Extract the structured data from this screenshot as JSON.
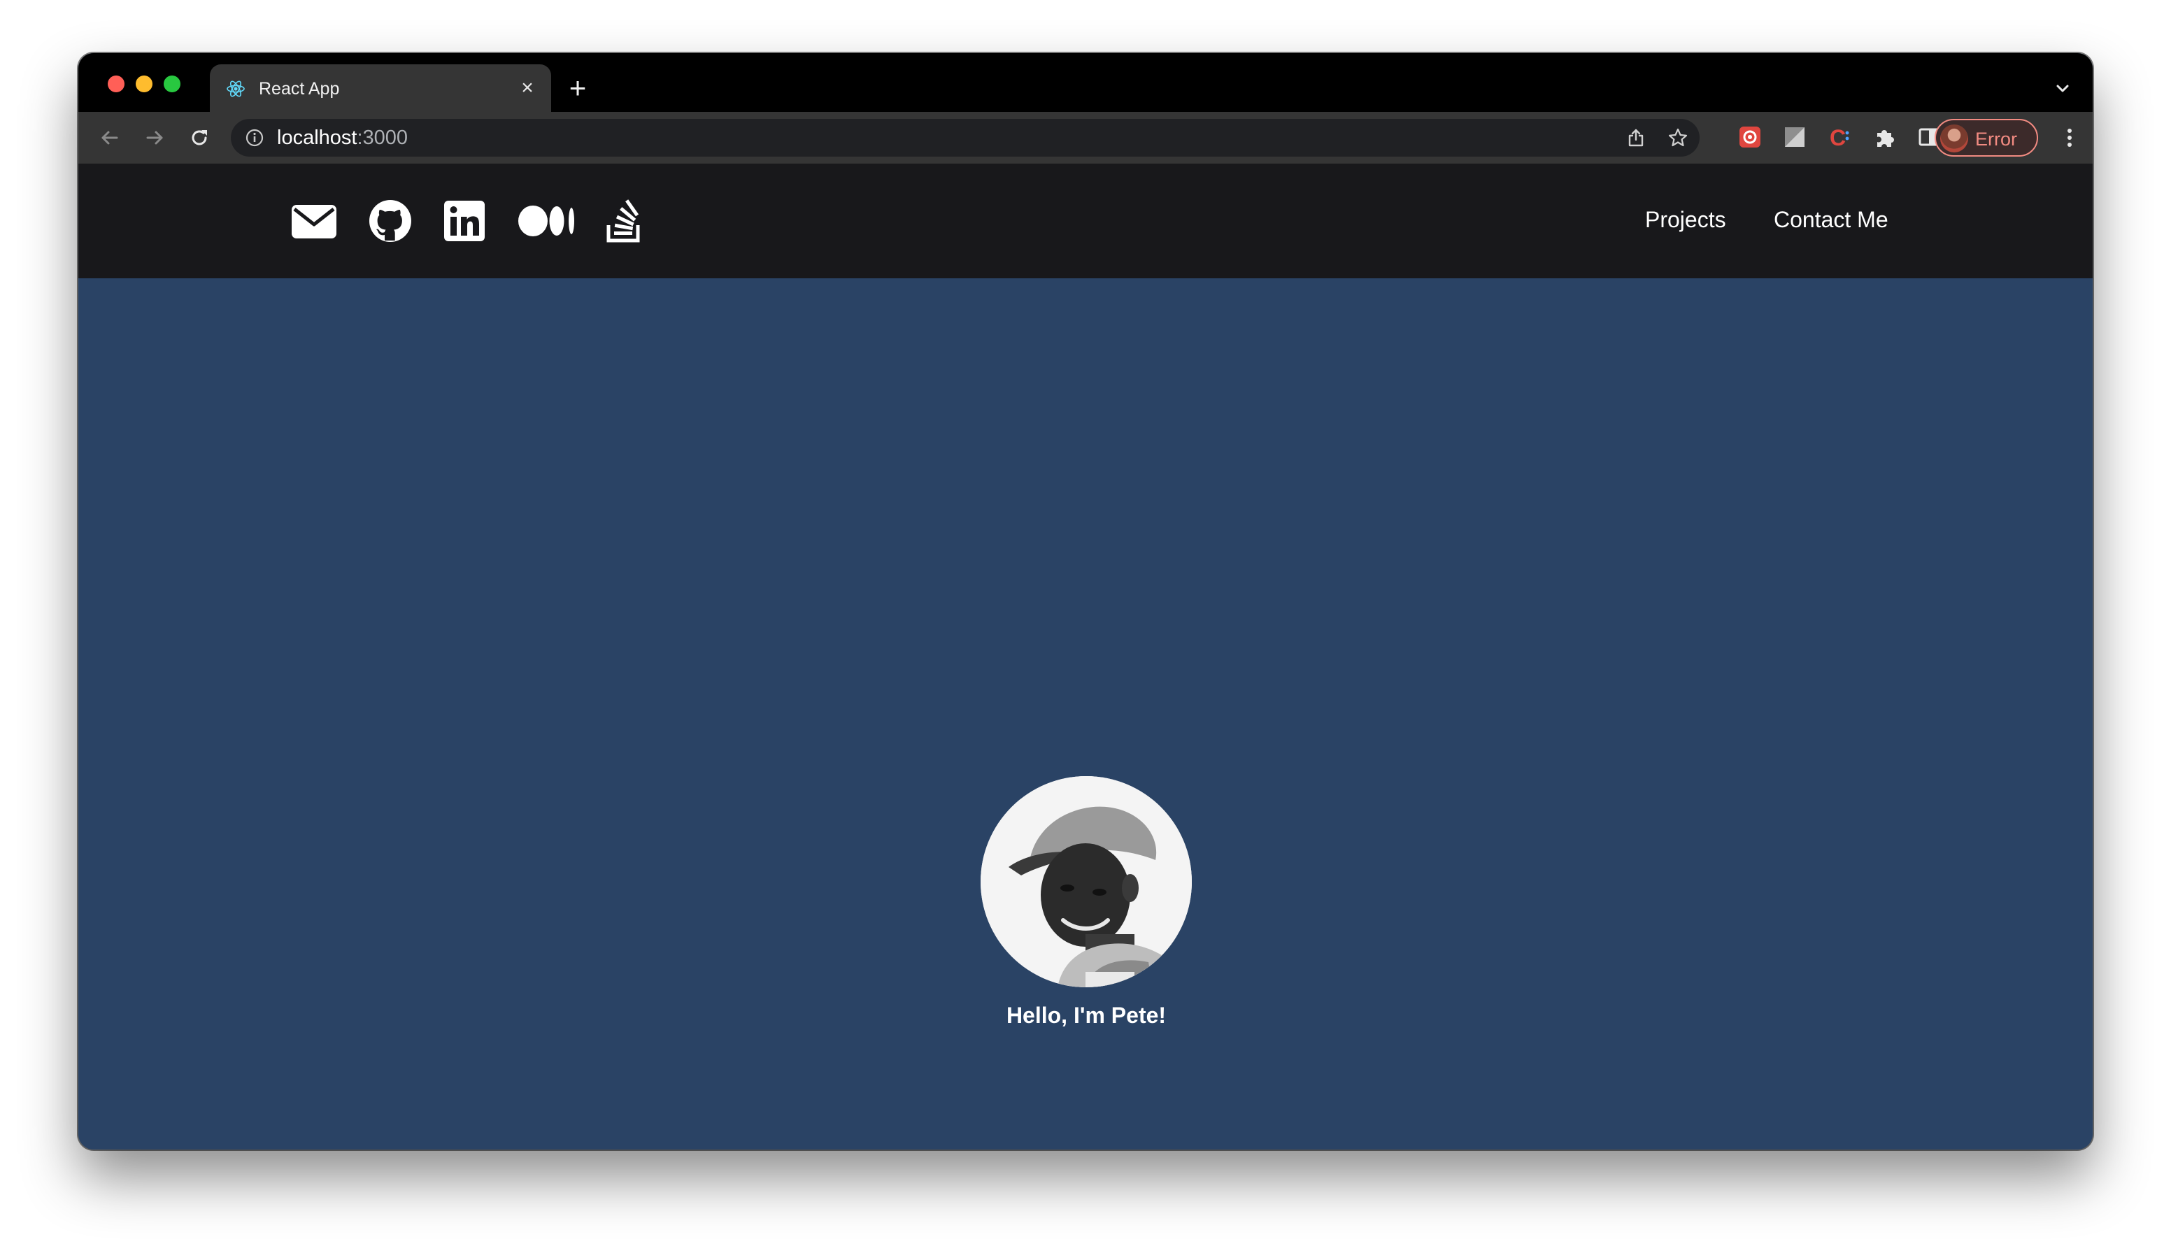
{
  "browser": {
    "tab": {
      "title": "React App",
      "favicon": "react-icon"
    },
    "new_tab_label": "+",
    "close_label": "×",
    "address": {
      "host": "localhost",
      "port": ":3000"
    },
    "profile": {
      "label": "Error",
      "accent": "#f28b82"
    }
  },
  "site": {
    "header": {
      "social_icons": [
        "envelope-icon",
        "github-icon",
        "linkedin-icon",
        "medium-icon",
        "stackoverflow-icon"
      ],
      "nav": {
        "projects": "Projects",
        "contact": "Contact Me"
      },
      "background": "#18181b"
    },
    "hero": {
      "greeting": "Hello, I'm Pete!",
      "background": "#2a4365"
    }
  }
}
